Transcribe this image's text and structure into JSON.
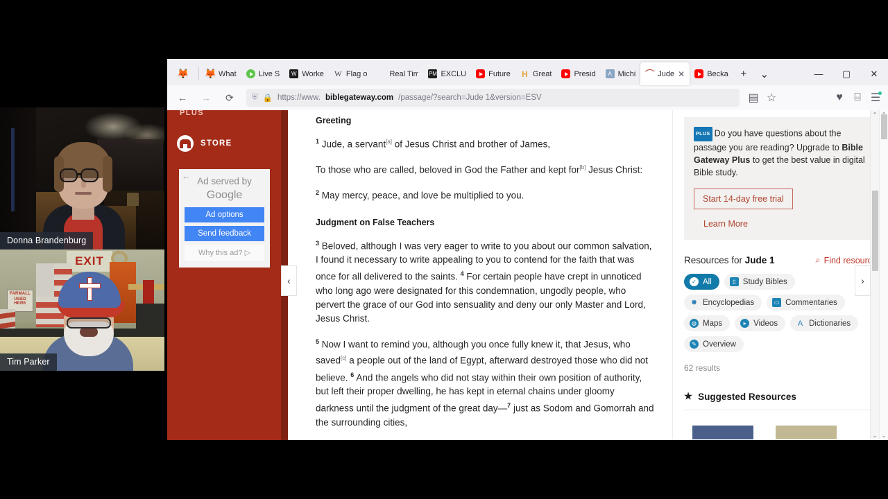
{
  "meeting": {
    "participants": [
      {
        "name": "Donna Brandenburg"
      },
      {
        "name": "Tim Parker"
      }
    ]
  },
  "browser": {
    "tabs": [
      {
        "label": "",
        "favicon": "firefox-icon",
        "active": false
      },
      {
        "label": "What",
        "favicon": "firefox-icon",
        "active": false
      },
      {
        "label": "Live S",
        "favicon": "play-circle-icon",
        "active": false
      },
      {
        "label": "Worke",
        "favicon": "dark-square-icon",
        "active": false
      },
      {
        "label": "Flag o",
        "favicon": "w-letter-icon",
        "active": false
      },
      {
        "label": "Real Time",
        "favicon": "blank-icon",
        "active": false
      },
      {
        "label": "EXCLU",
        "favicon": "pm-square-icon",
        "active": false
      },
      {
        "label": "Future",
        "favicon": "youtube-icon",
        "active": false
      },
      {
        "label": "Great",
        "favicon": "h-letter-icon",
        "active": false
      },
      {
        "label": "Presid",
        "favicon": "youtube-icon",
        "active": false
      },
      {
        "label": "Michi",
        "favicon": "blue-doc-icon",
        "active": false
      },
      {
        "label": "Jude",
        "favicon": "biblegateway-icon",
        "active": true
      },
      {
        "label": "Becka",
        "favicon": "youtube-icon",
        "active": false
      }
    ],
    "new_tab_label": "+",
    "tab_list_label": "⌄",
    "tab_close_label": "✕",
    "window_controls": {
      "minimize": "—",
      "maximize": "▢",
      "close": "✕"
    },
    "nav": {
      "back": "←",
      "forward": "→",
      "reload": "⟳"
    },
    "url": {
      "prefix": "https://www.",
      "domain": "biblegateway.com",
      "path": "/passage/?search=Jude 1&version=ESV",
      "shield_icon": "shield-icon",
      "lock_icon": "lock-icon"
    },
    "toolbar_icons": [
      "reader-mode-icon",
      "bookmark-star-icon",
      "pocket-icon",
      "extensions-icon",
      "app-menu-icon"
    ]
  },
  "sidebar": {
    "plus_label": "PLUS",
    "store_label": "STORE",
    "ad": {
      "back_arrow": "←",
      "line1": "Ad served by",
      "line2": "Google",
      "options_label": "Ad options",
      "feedback_label": "Send feedback",
      "why_label": "Why this ad? ▷"
    }
  },
  "passage": {
    "prev_label": "‹",
    "next_label": "›",
    "blocks": [
      {
        "type": "heading",
        "text": "Greeting"
      },
      {
        "type": "verse",
        "number": "1",
        "text": "Jude, a servant",
        "footnote": "[a]",
        "tail": " of Jesus Christ and brother of James,"
      },
      {
        "type": "para",
        "text_a": "To those who are called, beloved in God the Father and kept for",
        "footnote": "[b]",
        "text_b": " Jesus Christ:"
      },
      {
        "type": "verse",
        "number": "2",
        "text": "May mercy, peace, and love be multiplied to you.",
        "footnote": "",
        "tail": ""
      },
      {
        "type": "heading",
        "text": "Judgment on False Teachers"
      },
      {
        "type": "verse",
        "number": "3",
        "text": "Beloved, although I was very eager to write to you about our common salvation, I found it necessary to write appealing to you to contend for the faith that was once for all delivered to the saints. ",
        "footnote": "",
        "tail": ""
      },
      {
        "type": "verse",
        "number": "4",
        "text": "For certain people have crept in unnoticed who long ago were designated for this condemnation, ungodly people, who pervert the grace of our God into sensuality and deny our only Master and Lord, Jesus Christ.",
        "footnote": "",
        "tail": ""
      },
      {
        "type": "verse",
        "number": "5",
        "text": "Now I want to remind you, although you once fully knew it, that Jesus, who saved",
        "footnote": "[c]",
        "tail": " a people out of the land of Egypt, afterward destroyed those who did not believe. "
      },
      {
        "type": "verse",
        "number": "6",
        "text": "And the angels who did not stay within their own position of authority, but left their proper dwelling, he has kept in eternal chains under gloomy darkness until the judgment of the great day—",
        "footnote": "",
        "tail": ""
      },
      {
        "type": "verse",
        "number": "7",
        "text": "just as Sodom and Gomorrah and the surrounding cities,",
        "footnote": "",
        "tail": ""
      }
    ]
  },
  "right_panel": {
    "promo": {
      "badge": "PLUS",
      "text_1": "Do you have questions about the passage you are reading? Upgrade to ",
      "brand": "Bible Gateway Plus",
      "text_2": " to get the best value in digital Bible study.",
      "cta": "Start 14-day free trial",
      "learn_more": "Learn More"
    },
    "resources": {
      "title_prefix": "Resources for ",
      "title_ref": "Jude 1",
      "find_label": "Find resource",
      "find_icon": "search-icon",
      "chips": [
        {
          "label": "All",
          "icon": "check-circle-icon",
          "active": true
        },
        {
          "label": "Study Bibles",
          "icon": "book-icon",
          "active": false
        },
        {
          "label": "Encyclopedias",
          "icon": "globe-icon",
          "active": false
        },
        {
          "label": "Commentaries",
          "icon": "comment-icon",
          "active": false
        },
        {
          "label": "Maps",
          "icon": "map-globe-icon",
          "active": false
        },
        {
          "label": "Videos",
          "icon": "play-circle-icon",
          "active": false
        },
        {
          "label": "Dictionaries",
          "icon": "letter-a-icon",
          "active": false
        },
        {
          "label": "Overview",
          "icon": "pencil-circle-icon",
          "active": false
        }
      ],
      "results_count": "62 results",
      "suggested_title": "Suggested Resources",
      "suggested_icon": "star-icon"
    }
  },
  "scrollbars": {
    "up_arrow": "⌃",
    "down_arrow": "⌄"
  },
  "colors": {
    "brand_red": "#a32b18",
    "accent_blue": "#127aa8",
    "cta_red": "#b0432e",
    "google_blue": "#4285f4"
  }
}
